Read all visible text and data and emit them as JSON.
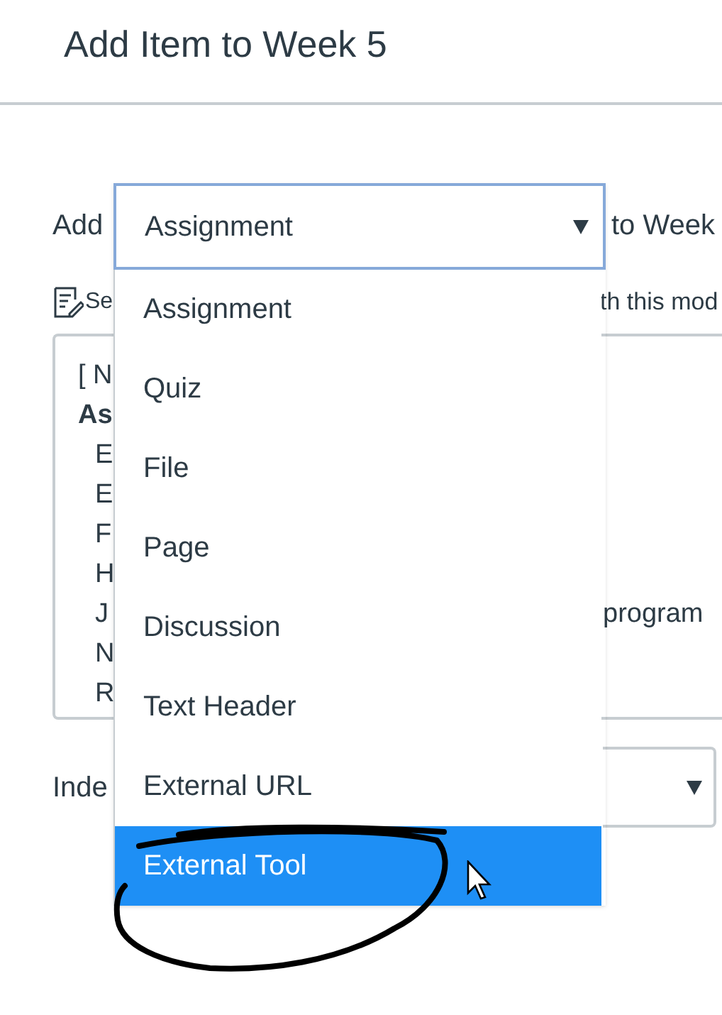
{
  "dialog": {
    "title": "Add Item to Week 5"
  },
  "add_row": {
    "label": "Add",
    "type_select": {
      "value": "Assignment"
    },
    "suffix": "to Week"
  },
  "hint": {
    "start": "Se",
    "end": "th this mod"
  },
  "item_list": [
    {
      "text": "[ N"
    },
    {
      "text": "As",
      "children": [
        {
          "text": "E"
        },
        {
          "text": "E"
        },
        {
          "text": "F"
        },
        {
          "text": "H"
        },
        {
          "text": "J",
          "end": "program"
        },
        {
          "text": "N"
        },
        {
          "text": "R"
        }
      ]
    }
  ],
  "indent_row": {
    "label": "Inde"
  },
  "type_options": [
    {
      "label": "Assignment",
      "selected": false
    },
    {
      "label": "Quiz",
      "selected": false
    },
    {
      "label": "File",
      "selected": false
    },
    {
      "label": "Page",
      "selected": false
    },
    {
      "label": "Discussion",
      "selected": false
    },
    {
      "label": "Text Header",
      "selected": false
    },
    {
      "label": "External URL",
      "selected": false
    },
    {
      "label": "External Tool",
      "selected": true
    }
  ]
}
